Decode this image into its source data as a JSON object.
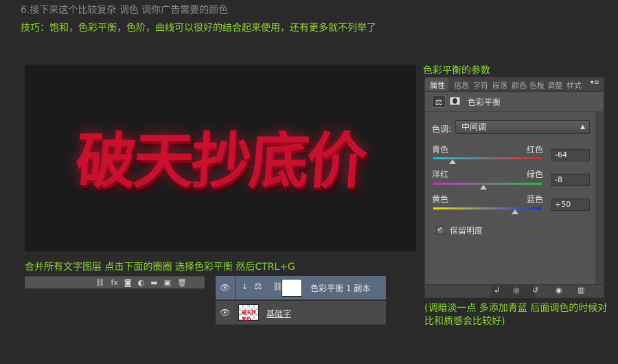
{
  "step_title": "6.接下来这个比较复杂 调色 调你广告需要的颜色",
  "tips": "技巧：饱和，色彩平衡，色阶，曲线可以很好的结合起来使用，还有更多就不列举了",
  "canvas": {
    "poster_text": "破天抄底价"
  },
  "merge_caption": "合并所有文字图层 点击下面的圈圈 选择色彩平衡 然后CTRL+G",
  "layer_toolbar": {
    "icons": [
      "link-icon",
      "fx-icon",
      "mask-icon",
      "adjustment-icon",
      "folder-icon",
      "new-layer-icon",
      "trash-icon"
    ],
    "link": "⛓",
    "fx": "fx",
    "mask": "◙",
    "adj": "◐",
    "folder": "▬",
    "new": "▣",
    "trash": "🗑"
  },
  "layers": {
    "selected": {
      "name": "色彩平衡 1 副本",
      "eye": "👁",
      "clip": "↓",
      "adj": "⚖",
      "chain": "⛓"
    },
    "base": {
      "name": "基础字",
      "thumb_text": "破天抄底价",
      "eye": "👁"
    }
  },
  "params_title": "色彩平衡的参数",
  "properties_panel": {
    "tabs": [
      "属性",
      "信息",
      "字符",
      "段落",
      "颜色",
      "色板",
      "调整",
      "样式"
    ],
    "menu": "▾≡",
    "header_title": "色彩平衡",
    "tone_label": "色调:",
    "tone_value": "中间调",
    "sliders": [
      {
        "left": "青色",
        "right": "红色",
        "value": "-64",
        "position": 0.18,
        "colors": [
          "#17c6d4",
          "#e0242a"
        ]
      },
      {
        "left": "洋红",
        "right": "绿色",
        "value": "-8",
        "position": 0.46,
        "colors": [
          "#d22bd2",
          "#21c23a"
        ]
      },
      {
        "left": "黄色",
        "right": "蓝色",
        "value": "+50",
        "position": 0.75,
        "colors": [
          "#e8e21e",
          "#1c2be0"
        ]
      }
    ],
    "preserve_luminosity": {
      "label": "保留明度",
      "checked": true
    }
  },
  "bottom_note": "(调暗淡一点 多添加青蓝 后面调色的时候对比和质感会比较好)",
  "colors": {
    "accent_green": "#8fd630",
    "panel": "#535353",
    "background": "#2a2a2a"
  }
}
